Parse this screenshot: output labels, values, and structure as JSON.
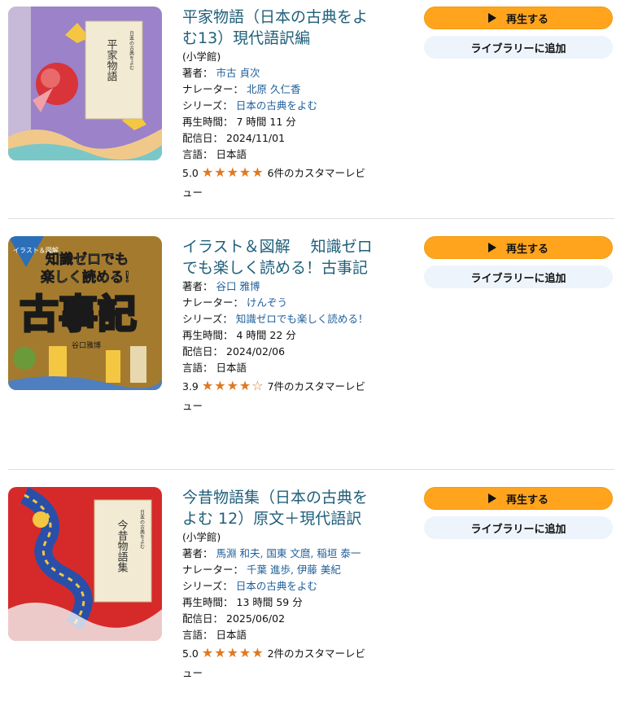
{
  "items": [
    {
      "title": "平家物語（日本の古典をよむ13）現代語訳編",
      "publisher": "(小学館)",
      "author_label": "著者：",
      "author": "市古 貞次",
      "narrator_label": "ナレーター：",
      "narrator": "北原 久仁香",
      "series_label": "シリーズ：",
      "series": "日本の古典をよむ",
      "length_label": "再生時間：",
      "length": "7 時間 11 分",
      "release_label": "配信日：",
      "release": "2024/11/01",
      "language_label": "言語：",
      "language": "日本語",
      "rating": "5.0",
      "rating_stars": 5,
      "reviews": "6件のカスタマーレビュー",
      "play_label": "再生する",
      "library_label": "ライブラリーに追加",
      "cover_text": [
        "平家物語",
        "日本の古典をよむ"
      ],
      "cover_colors": [
        "#9b82c9",
        "#e8d9b5",
        "#f2b3c0"
      ]
    },
    {
      "title": "イラスト＆図解　 知識ゼロでも楽しく読める！古事記",
      "publisher": "",
      "author_label": "著者：",
      "author": "谷口 雅博",
      "narrator_label": "ナレーター：",
      "narrator": "けんぞう",
      "series_label": "シリーズ：",
      "series": "知識ゼロでも楽しく読める！",
      "length_label": "再生時間：",
      "length": "4 時間 22 分",
      "release_label": "配信日：",
      "release": "2024/02/06",
      "language_label": "言語：",
      "language": "日本語",
      "rating": "3.9",
      "rating_stars": 4,
      "reviews": "7件のカスタマーレビュー",
      "play_label": "再生する",
      "library_label": "ライブラリーに追加",
      "cover_text": [
        "知識ゼロでも",
        "楽しく読める！",
        "古事記",
        "イラスト＆図解",
        "谷口雅博"
      ],
      "cover_colors": [
        "#a47b2e",
        "#ffffff",
        "#1a1a1a"
      ]
    },
    {
      "title": "今昔物語集（日本の古典をよむ 12）原文＋現代語訳",
      "publisher": "(小学館)",
      "author_label": "著者：",
      "author": "馬淵 和夫, 国東 文麿, 稲垣 泰一",
      "narrator_label": "ナレーター：",
      "narrator": "千葉 進歩, 伊藤 美紀",
      "series_label": "シリーズ：",
      "series": "日本の古典をよむ",
      "length_label": "再生時間：",
      "length": "13 時間 59 分",
      "release_label": "配信日：",
      "release": "2025/06/02",
      "language_label": "言語：",
      "language": "日本語",
      "rating": "5.0",
      "rating_stars": 5,
      "reviews": "2件のカスタマーレビュー",
      "play_label": "再生する",
      "library_label": "ライブラリーに追加",
      "cover_text": [
        "今昔物語集",
        "日本の古典をよむ"
      ],
      "cover_colors": [
        "#d62a2a",
        "#2a4fa8",
        "#e8d9b5"
      ]
    }
  ],
  "icons": {
    "play": "play-icon",
    "star": "star-icon"
  }
}
